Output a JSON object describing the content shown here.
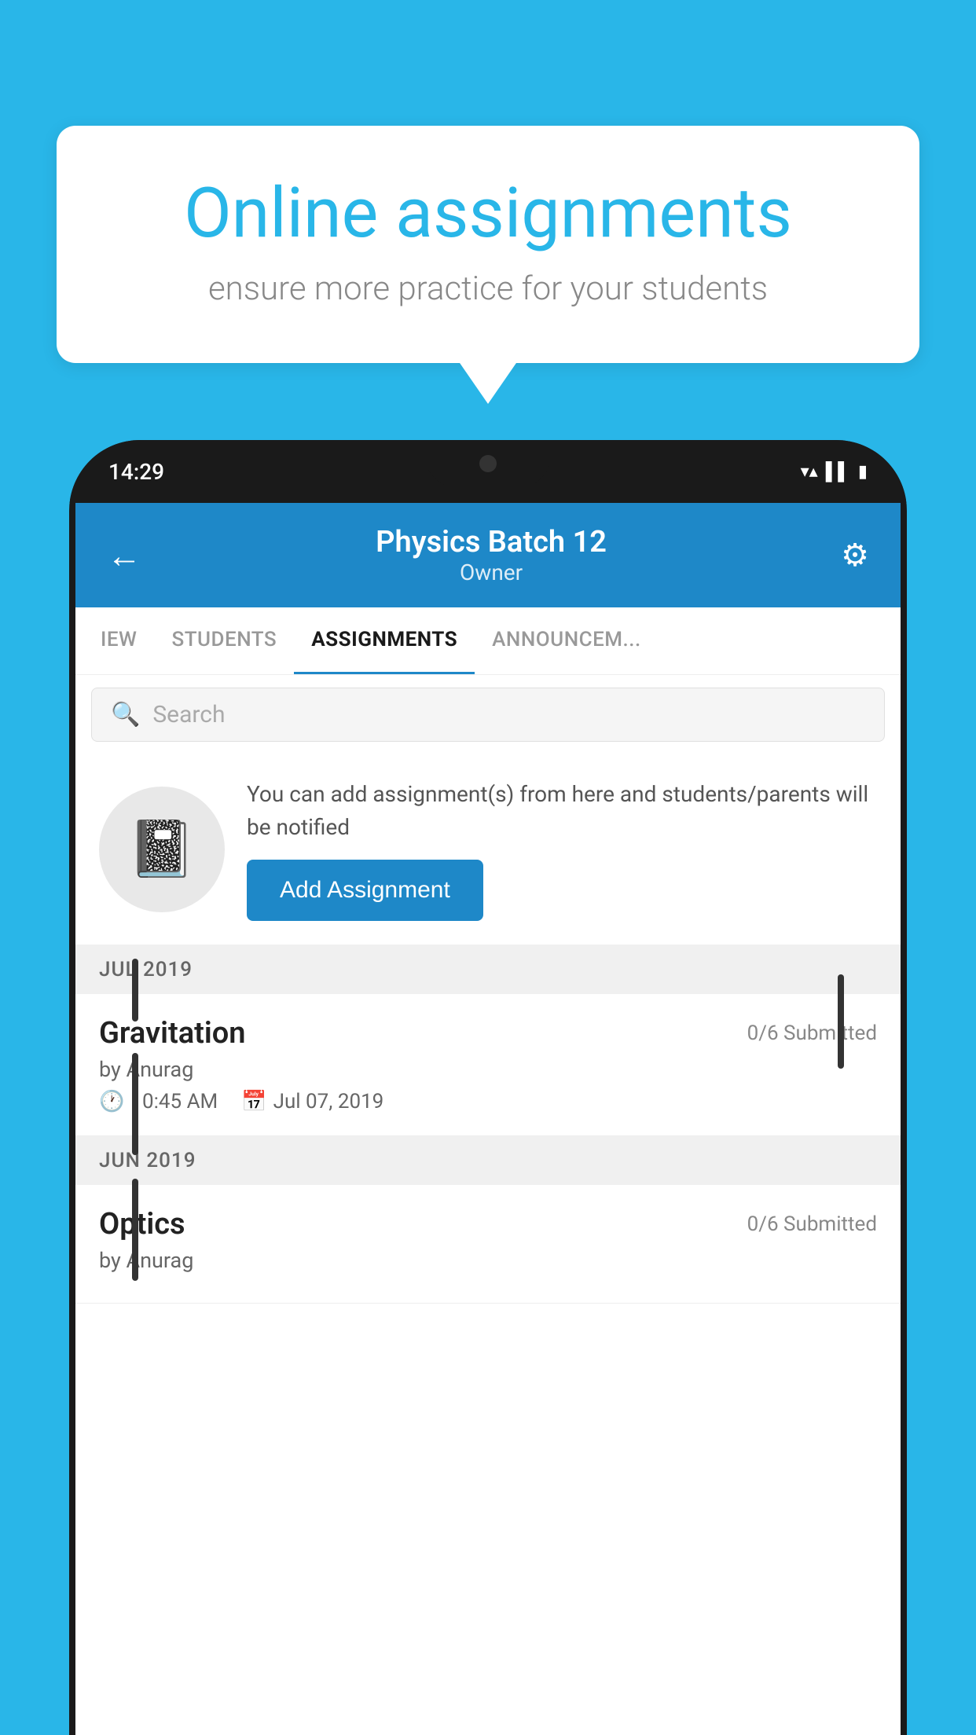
{
  "background_color": "#29B6E8",
  "speech_bubble": {
    "title": "Online assignments",
    "subtitle": "ensure more practice for your students"
  },
  "phone": {
    "status_time": "14:29",
    "status_icons": [
      "wifi",
      "signal",
      "battery"
    ]
  },
  "app_header": {
    "title": "Physics Batch 12",
    "subtitle": "Owner",
    "back_label": "←",
    "settings_label": "⚙"
  },
  "tabs": [
    {
      "label": "IEW",
      "active": false
    },
    {
      "label": "STUDENTS",
      "active": false
    },
    {
      "label": "ASSIGNMENTS",
      "active": true
    },
    {
      "label": "ANNOUNCEM...",
      "active": false
    }
  ],
  "search": {
    "placeholder": "Search"
  },
  "promo": {
    "text": "You can add assignment(s) from here and students/parents will be notified",
    "button_label": "Add Assignment"
  },
  "sections": [
    {
      "month": "JUL 2019",
      "assignments": [
        {
          "title": "Gravitation",
          "submitted": "0/6 Submitted",
          "by": "by Anurag",
          "time": "10:45 AM",
          "date": "Jul 07, 2019"
        }
      ]
    },
    {
      "month": "JUN 2019",
      "assignments": [
        {
          "title": "Optics",
          "submitted": "0/6 Submitted",
          "by": "by Anurag",
          "time": "",
          "date": ""
        }
      ]
    }
  ]
}
